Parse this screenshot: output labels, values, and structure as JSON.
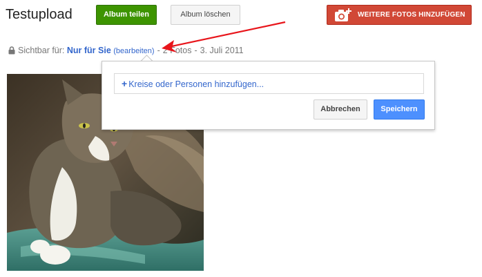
{
  "album": {
    "title": "Testupload",
    "share_label": "Album teilen",
    "delete_label": "Album löschen",
    "add_photos_label": "WEITERE FOTOS HINZUFÜGEN"
  },
  "visibility": {
    "label": "Sichtbar für:",
    "value": "Nur für Sie",
    "edit_label": "(bearbeiten)",
    "separator": "-",
    "photo_count": "2 Fotos",
    "date": "3. Juli 2011"
  },
  "share_popup": {
    "plus": "+",
    "input_placeholder": "Kreise oder Personen hinzufügen...",
    "cancel_label": "Abbrechen",
    "save_label": "Speichern"
  },
  "colors": {
    "share_button": "#3d9400",
    "add_photos_button": "#d14836",
    "save_button": "#4d90fe",
    "link": "#3366cc",
    "arrow": "#e8151b"
  },
  "icons": {
    "camera": "camera-plus-icon",
    "lock": "lock-icon"
  }
}
